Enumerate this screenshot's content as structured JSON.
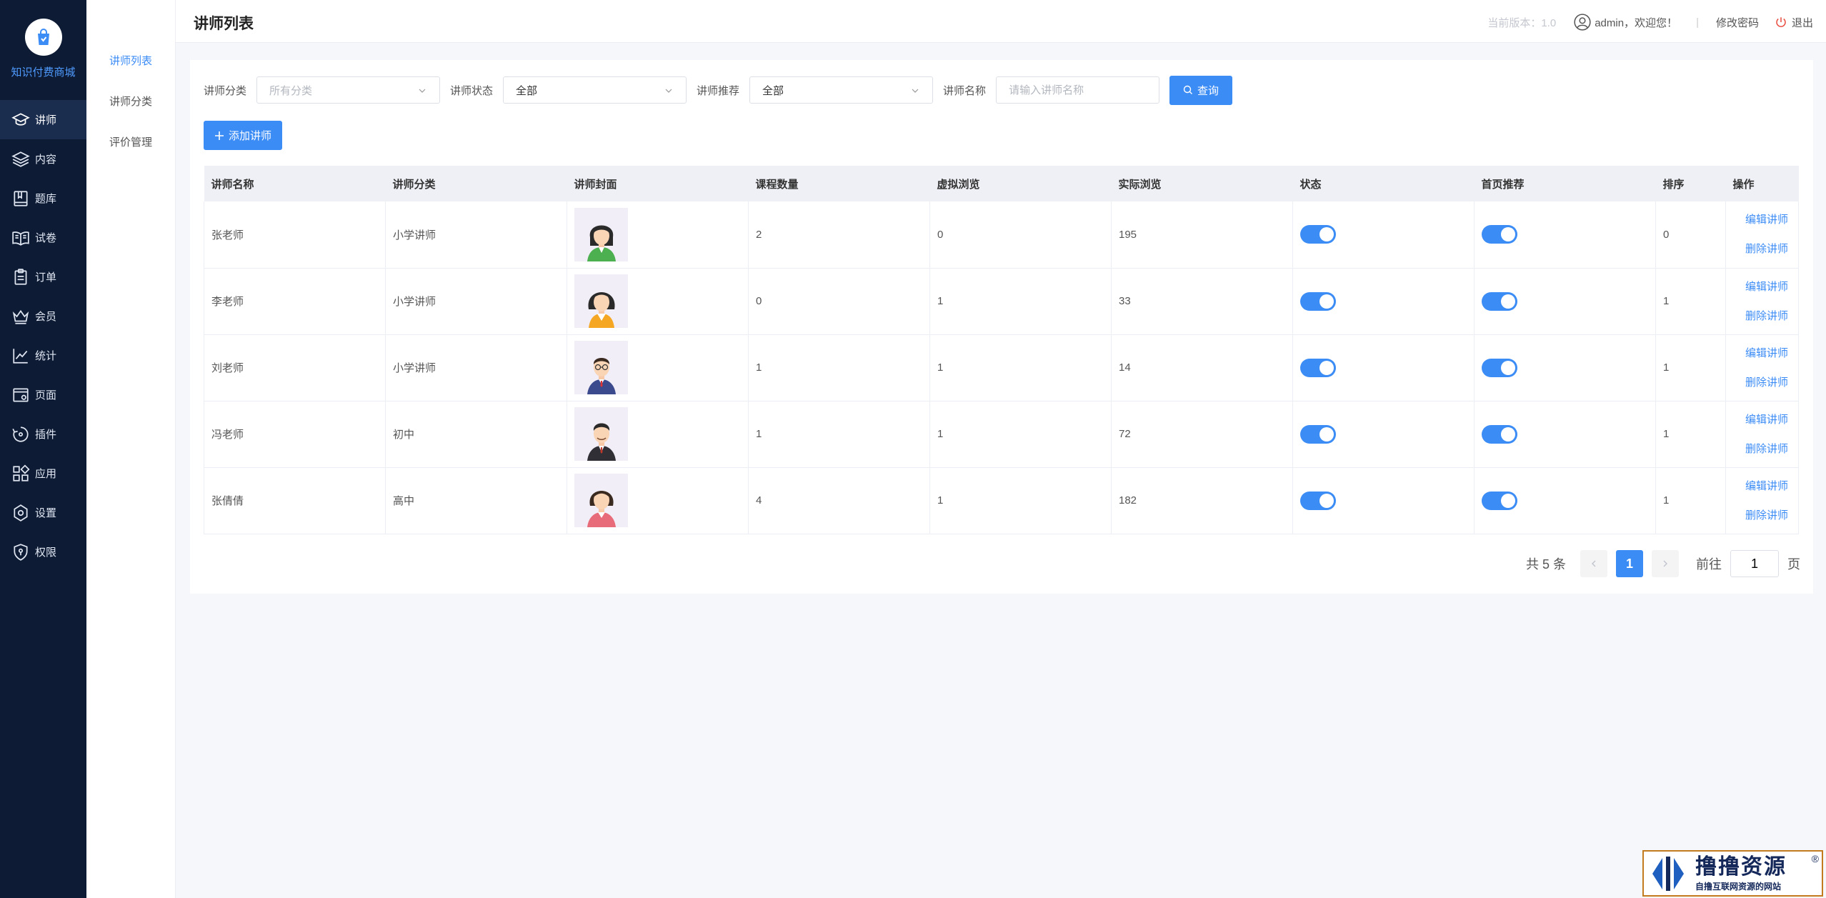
{
  "app": {
    "name": "知识付费商城"
  },
  "nav": [
    {
      "label": "讲师",
      "icon": "graduation-cap-icon",
      "active": true
    },
    {
      "label": "内容",
      "icon": "layers-icon",
      "active": false
    },
    {
      "label": "题库",
      "icon": "book-icon",
      "active": false
    },
    {
      "label": "试卷",
      "icon": "open-book-icon",
      "active": false
    },
    {
      "label": "订单",
      "icon": "clipboard-icon",
      "active": false
    },
    {
      "label": "会员",
      "icon": "crown-icon",
      "active": false
    },
    {
      "label": "统计",
      "icon": "line-chart-icon",
      "active": false
    },
    {
      "label": "页面",
      "icon": "page-settings-icon",
      "active": false
    },
    {
      "label": "插件",
      "icon": "plugin-icon",
      "active": false
    },
    {
      "label": "应用",
      "icon": "apps-grid-icon",
      "active": false
    },
    {
      "label": "设置",
      "icon": "gear-icon",
      "active": false
    },
    {
      "label": "权限",
      "icon": "shield-icon",
      "active": false
    }
  ],
  "subnav": [
    {
      "label": "讲师列表",
      "active": true
    },
    {
      "label": "讲师分类",
      "active": false
    },
    {
      "label": "评价管理",
      "active": false
    }
  ],
  "header": {
    "title": "讲师列表",
    "version_label": "当前版本：1.0",
    "user": "admin，欢迎您！",
    "separator": "|",
    "change_password": "修改密码",
    "logout": "退出"
  },
  "filters": {
    "category_label": "讲师分类",
    "category_value": "所有分类",
    "status_label": "讲师状态",
    "status_value": "全部",
    "recommend_label": "讲师推荐",
    "recommend_value": "全部",
    "name_label": "讲师名称",
    "name_placeholder": "请输入讲师名称",
    "name_value": "",
    "search_button": "查询"
  },
  "add_button": "添加讲师",
  "table": {
    "columns": [
      "讲师名称",
      "讲师分类",
      "讲师封面",
      "课程数量",
      "虚拟浏览",
      "实际浏览",
      "状态",
      "首页推荐",
      "排序",
      "操作"
    ],
    "rows": [
      {
        "name": "张老师",
        "category": "小学讲师",
        "cover": "female-teacher-avatar-icon",
        "courses": "2",
        "virtual_views": "0",
        "actual_views": "195",
        "status_on": true,
        "recommend_on": true,
        "sort": "0",
        "edit": "编辑讲师",
        "delete": "删除讲师"
      },
      {
        "name": "李老师",
        "category": "小学讲师",
        "cover": "female-teacher-avatar-icon",
        "courses": "0",
        "virtual_views": "1",
        "actual_views": "33",
        "status_on": true,
        "recommend_on": true,
        "sort": "1",
        "edit": "编辑讲师",
        "delete": "删除讲师"
      },
      {
        "name": "刘老师",
        "category": "小学讲师",
        "cover": "male-teacher-glasses-avatar-icon",
        "courses": "1",
        "virtual_views": "1",
        "actual_views": "14",
        "status_on": true,
        "recommend_on": true,
        "sort": "1",
        "edit": "编辑讲师",
        "delete": "删除讲师"
      },
      {
        "name": "冯老师",
        "category": "初中",
        "cover": "male-teacher-avatar-icon",
        "courses": "1",
        "virtual_views": "1",
        "actual_views": "72",
        "status_on": true,
        "recommend_on": true,
        "sort": "1",
        "edit": "编辑讲师",
        "delete": "删除讲师"
      },
      {
        "name": "张倩倩",
        "category": "高中",
        "cover": "female-teacher-avatar-icon",
        "courses": "4",
        "virtual_views": "1",
        "actual_views": "182",
        "status_on": true,
        "recommend_on": true,
        "sort": "1",
        "edit": "编辑讲师",
        "delete": "删除讲师"
      }
    ]
  },
  "pagination": {
    "total": "共 5 条",
    "current_page": "1",
    "goto_label": "前往",
    "goto_value": "1",
    "page_unit": "页"
  },
  "watermark": {
    "main": "撸撸资源",
    "sub": "自撸互联网资源的网站",
    "reg": "®"
  },
  "colors": {
    "primary": "#3c8cf5",
    "nav_bg": "#0d1b34",
    "nav_active": "#1b2d4e",
    "page_bg": "#f5f7fb",
    "table_header_bg": "#eef0f5"
  }
}
